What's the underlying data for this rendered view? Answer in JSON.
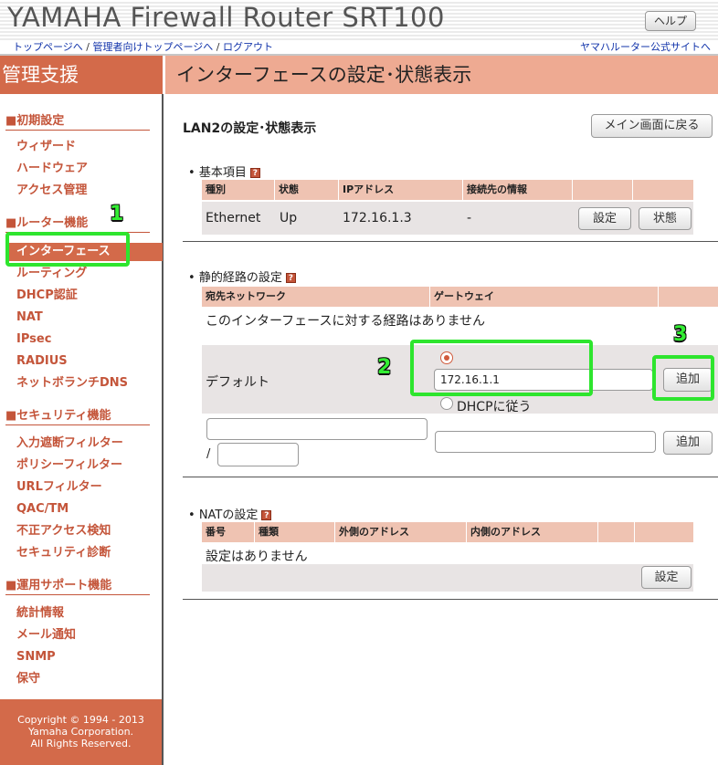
{
  "header": {
    "app_title": "YAMAHA Firewall Router SRT100",
    "help_label": "ヘルプ",
    "nav_top": "トップページへ",
    "nav_admin_top": "管理者向けトップページへ",
    "nav_logout": "ログアウト",
    "nav_separator": "/",
    "nav_official": "ヤマハルーター公式サイトへ"
  },
  "sidebar": {
    "heading": "管理支援",
    "sections": [
      {
        "title": "■初期設定",
        "items": [
          "ウィザード",
          "ハードウェア",
          "アクセス管理"
        ]
      },
      {
        "title": "■ルーター機能",
        "items": [
          "インターフェース",
          "ルーティング",
          "DHCP認証",
          "NAT",
          "IPsec",
          "RADIUS",
          "ネットボランチDNS"
        ]
      },
      {
        "title": "■セキュリティ機能",
        "items": [
          "入力遮断フィルター",
          "ポリシーフィルター",
          "URLフィルター",
          "QAC/TM",
          "不正アクセス検知",
          "セキュリティ診断"
        ]
      },
      {
        "title": "■運用サポート機能",
        "items": [
          "統計情報",
          "メール通知",
          "SNMP",
          "保守"
        ]
      }
    ],
    "active_item": "インターフェース",
    "copyright": [
      "Copyright © 1994 - 2013",
      "Yamaha Corporation.",
      "All Rights Reserved."
    ]
  },
  "main": {
    "heading": "インターフェースの設定･状態表示",
    "subtitle": "LAN2の設定･状態表示",
    "back_button": "メイン画面に戻る",
    "basic": {
      "label": "基本項目",
      "help_icon": "?",
      "columns": [
        "種別",
        "状態",
        "IPアドレス",
        "接続先の情報"
      ],
      "row": {
        "type": "Ethernet",
        "state": "Up",
        "ip": "172.16.1.3",
        "peer": "-"
      },
      "settings_button": "設定",
      "status_button": "状態"
    },
    "static_route": {
      "label": "静的経路の設定",
      "help_icon": "?",
      "columns": [
        "宛先ネットワーク",
        "ゲートウェイ"
      ],
      "empty_message": "このインターフェースに対する経路はありません",
      "default_label": "デフォルト",
      "gateway_value": "172.16.1.1",
      "dhcp_label": "DHCPに従う",
      "add_button": "追加",
      "slash": "/",
      "add_button_2": "追加"
    },
    "nat": {
      "label": "NATの設定",
      "help_icon": "?",
      "columns": [
        "番号",
        "種類",
        "外側のアドレス",
        "内側のアドレス"
      ],
      "empty_message": "設定はありません",
      "settings_button": "設定"
    }
  },
  "annotations": [
    "1",
    "2",
    "3"
  ],
  "colors": {
    "accent": "#d36a4a",
    "accent_light": "#eeaa92",
    "highlight": "#2ee52e"
  }
}
